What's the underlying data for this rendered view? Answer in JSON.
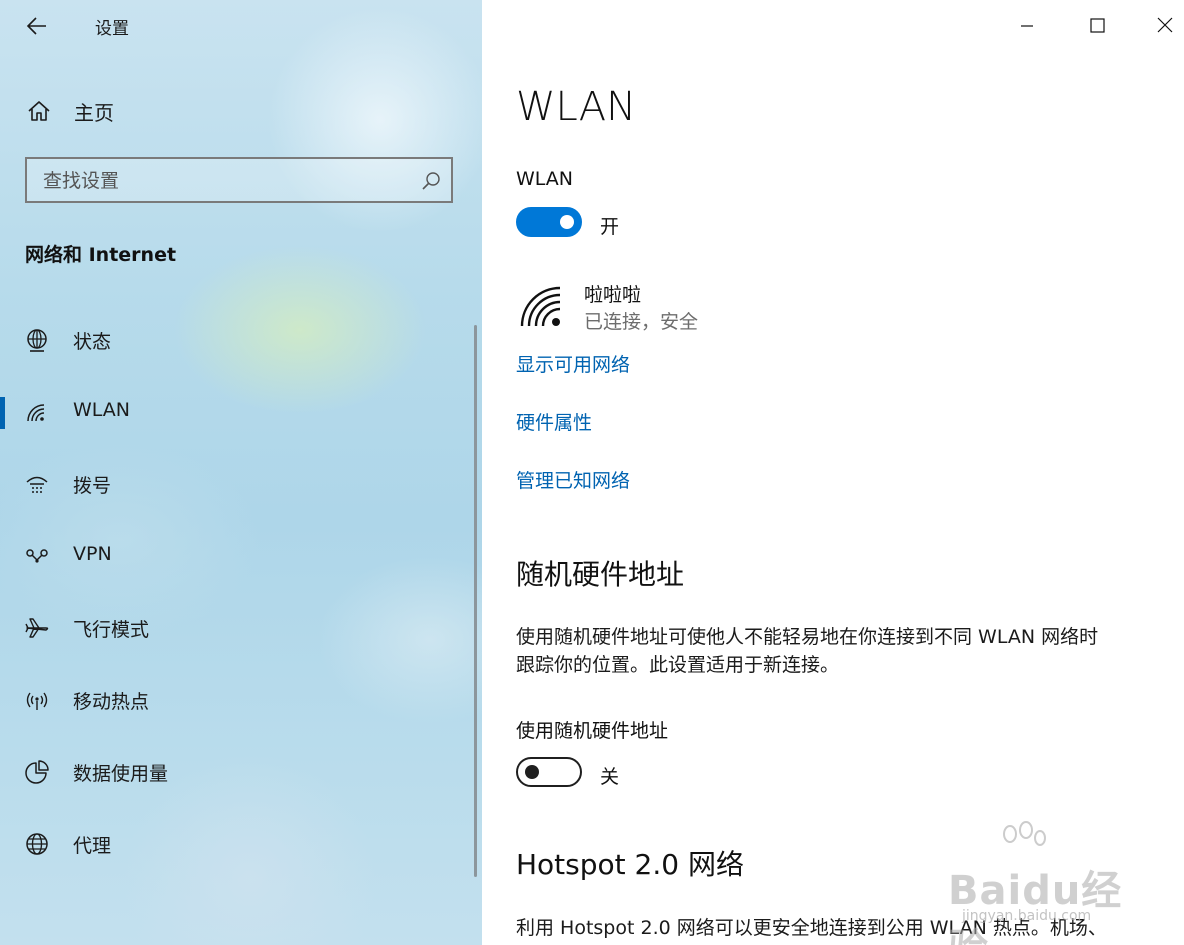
{
  "window": {
    "app_title": "设置",
    "controls": [
      "minimize",
      "maximize",
      "close"
    ]
  },
  "sidebar": {
    "home_label": "主页",
    "search_placeholder": "查找设置",
    "section_title": "网络和 Internet",
    "selected_index": 1,
    "accent_color": "#0063b1",
    "items": [
      {
        "label": "状态",
        "icon": "status-globe-icon"
      },
      {
        "label": "WLAN",
        "icon": "wifi-icon"
      },
      {
        "label": "拨号",
        "icon": "dialup-icon"
      },
      {
        "label": "VPN",
        "icon": "vpn-icon"
      },
      {
        "label": "飞行模式",
        "icon": "airplane-icon"
      },
      {
        "label": "移动热点",
        "icon": "hotspot-icon"
      },
      {
        "label": "数据使用量",
        "icon": "data-usage-icon"
      },
      {
        "label": "代理",
        "icon": "proxy-globe-icon"
      }
    ]
  },
  "main": {
    "page_title": "WLAN",
    "wlan_toggle": {
      "label": "WLAN",
      "state": "开",
      "on": true
    },
    "network": {
      "name": "啦啦啦",
      "status": "已连接，安全"
    },
    "links": [
      "显示可用网络",
      "硬件属性",
      "管理已知网络"
    ],
    "random_hw": {
      "heading": "随机硬件地址",
      "description_line1": "使用随机硬件地址可使他人不能轻易地在你连接到不同 WLAN 网络时",
      "description_line2": "跟踪你的位置。此设置适用于新连接。",
      "toggle_label": "使用随机硬件地址",
      "toggle_state": "关",
      "on": false
    },
    "hotspot": {
      "heading": "Hotspot 2.0 网络",
      "description": "利用 Hotspot 2.0 网络可以更安全地连接到公用 WLAN 热点。机场、"
    },
    "link_color": "#0063b1",
    "toggle_on_color": "#0078d7"
  },
  "watermark": {
    "text": "Baidu经验",
    "url": "jingyan.baidu.com"
  }
}
